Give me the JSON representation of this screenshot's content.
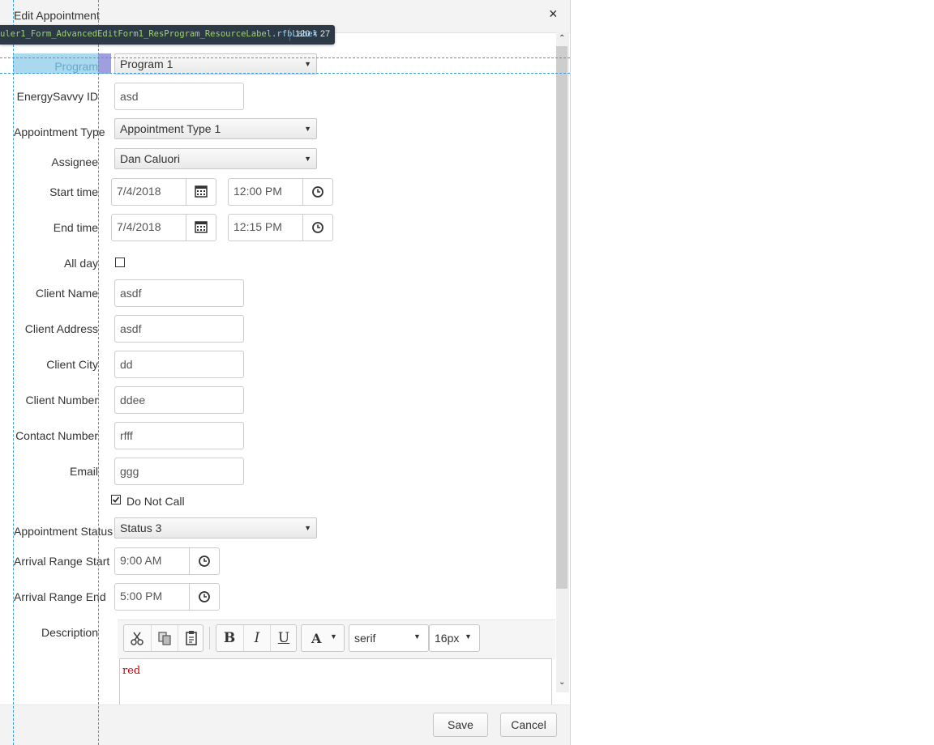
{
  "dialog": {
    "title": "Edit Appointment",
    "close_glyph": "×",
    "devtools_tooltip": {
      "selector_prefix": "uler1_Form_AdvancedEditForm1_ResProgram_ResourceLabel",
      "selector_suffix": ".rfbLabel",
      "dimensions": "120 × 27"
    }
  },
  "form": {
    "program": {
      "label": "Program",
      "value": "Program 1"
    },
    "energysavvy_id": {
      "label": "EnergySavvy ID",
      "value": "asd"
    },
    "appointment_type": {
      "label": "Appointment Type",
      "value": "Appointment Type 1"
    },
    "assignee": {
      "label": "Assignee",
      "value": "Dan Caluori"
    },
    "start_time": {
      "label": "Start time",
      "date": "7/4/2018",
      "time": "12:00 PM"
    },
    "end_time": {
      "label": "End time",
      "date": "7/4/2018",
      "time": "12:15 PM"
    },
    "all_day": {
      "label": "All day",
      "checked": false
    },
    "client_name": {
      "label": "Client Name",
      "value": "asdf"
    },
    "client_address": {
      "label": "Client Address",
      "value": "asdf"
    },
    "client_city": {
      "label": "Client City",
      "value": "dd"
    },
    "client_number": {
      "label": "Client Number",
      "value": "ddee"
    },
    "contact_number": {
      "label": "Contact Number",
      "value": "rfff"
    },
    "email": {
      "label": "Email",
      "value": "ggg"
    },
    "do_not_call": {
      "label": "Do Not Call",
      "checked": true
    },
    "appointment_status": {
      "label": "Appointment Status",
      "value": "Status 3"
    },
    "arrival_range_start": {
      "label": "Arrival Range Start",
      "value": "9:00 AM"
    },
    "arrival_range_end": {
      "label": "Arrival Range End",
      "value": "5:00 PM"
    },
    "description": {
      "label": "Description",
      "toolbar": {
        "bold": "B",
        "italic": "I",
        "underline": "U",
        "font_color": "A",
        "font_name": "serif",
        "font_size": "16px"
      },
      "content": "red",
      "content_color": "#cc0000"
    }
  },
  "footer": {
    "save_label": "Save",
    "cancel_label": "Cancel"
  },
  "colors": {
    "guide": "#3aa0d8",
    "highlight_label": "#a9d8ef",
    "highlight_padding": "#9f9fe0",
    "tooltip_bg": "#2d3a46"
  }
}
